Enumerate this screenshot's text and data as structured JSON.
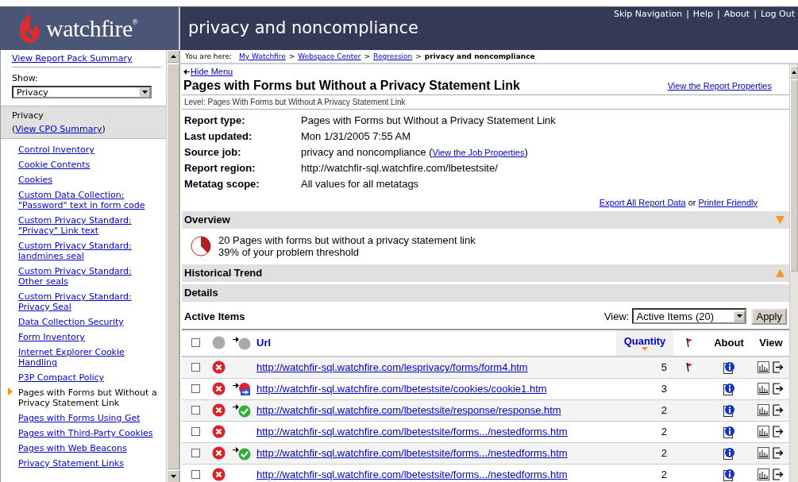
{
  "header": {
    "logo_text": "watchfire",
    "logo_mark": "®",
    "title": "privacy and noncompliance",
    "links": [
      "Skip Navigation",
      "Help",
      "About",
      "Log Out"
    ],
    "separator": "|"
  },
  "sidebar": {
    "summary_link": "View Report Pack Summary",
    "show_label": "Show:",
    "show_value": "Privacy",
    "group_title": "Privacy",
    "group_link_open": "(",
    "group_link": "View CPO Summary",
    "group_link_close": ")",
    "items": [
      {
        "label": "Control Inventory",
        "selected": false
      },
      {
        "label": "Cookie Contents",
        "selected": false
      },
      {
        "label": "Cookies",
        "selected": false
      },
      {
        "label": "Custom Data Collection: \"Password\" text in form code",
        "selected": false
      },
      {
        "label": "Custom Privacy Standard: \"Privacy\" Link text",
        "selected": false
      },
      {
        "label": "Custom Privacy Standard: landmines seal",
        "selected": false
      },
      {
        "label": "Custom Privacy Standard: Other seals",
        "selected": false
      },
      {
        "label": "Custom Privacy Standard: Privacy Seal",
        "selected": false
      },
      {
        "label": "Data Collection Security",
        "selected": false
      },
      {
        "label": "Form Inventory",
        "selected": false
      },
      {
        "label": "Internet Explorer Cookie Handling",
        "selected": false
      },
      {
        "label": "P3P Compact Policy",
        "selected": false
      },
      {
        "label": "Pages with Forms but Without a Privacy Statement Link",
        "selected": true
      },
      {
        "label": "Pages with Forms Using Get",
        "selected": false
      },
      {
        "label": "Pages with Third-Party Cookies",
        "selected": false
      },
      {
        "label": "Pages with Web Beacons",
        "selected": false
      },
      {
        "label": "Privacy Statement Links",
        "selected": false
      }
    ]
  },
  "breadcrumb": {
    "prefix": "You are here:",
    "links": [
      "My Watchfire",
      "Webspace Center",
      "Regression"
    ],
    "separator": ">",
    "current": "privacy and noncompliance"
  },
  "hide_menu": "Hide Menu",
  "report": {
    "title": "Pages with Forms but Without a Privacy Statement Link",
    "properties_link": "View the Report Properties",
    "level": "Level:  Pages With Forms but Without A Privacy Statement Link",
    "properties": [
      {
        "label": "Report type:",
        "value": "Pages with Forms but Without a Privacy Statement Link"
      },
      {
        "label": "Last updated:",
        "value": "Mon 1/31/2005 7:55 AM"
      },
      {
        "label": "Source job:",
        "value": "privacy and noncompliance",
        "link_open": "(",
        "link": "View the Job Properties",
        "link_close": ")"
      },
      {
        "label": "Report region:",
        "value": "http://watchfir-sql.watchfire.com/lbetestsite/"
      },
      {
        "label": "Metatag scope:",
        "value": "All values for all metatags"
      }
    ],
    "export_link": "Export All Report Data",
    "export_or": "or",
    "printer_link": "Printer Friendly"
  },
  "sections": [
    {
      "title": "Overview",
      "kind": "expanded"
    },
    {
      "title": "Historical Trend",
      "kind": "collapsed"
    },
    {
      "title": "Details",
      "kind": "plain"
    }
  ],
  "overview": {
    "lines": [
      "20 Pages with forms but without a privacy statement link",
      "39% of your problem threshold"
    ]
  },
  "active_items": {
    "title": "Active Items",
    "view_label": "View:",
    "view_value": "Active Items (20)",
    "apply": "Apply"
  },
  "table": {
    "all_checked": false,
    "columns": [
      {
        "label": "Url",
        "sorted": false
      },
      {
        "label": "Quantity",
        "sorted": true
      },
      {
        "label": "About",
        "sorted": false
      },
      {
        "label": "View",
        "sorted": false
      }
    ],
    "rows": [
      {
        "checked": false,
        "kind": "plain",
        "url": "http://watchfir-sql.watchfire.com/lesprivacy/forms/form4.htm",
        "quantity": "5",
        "flagged": true
      },
      {
        "checked": false,
        "kind": "new",
        "url": "http://watchfir-sql.watchfire.com/lbetestsite/cookies/cookie1.htm",
        "quantity": "3",
        "flagged": false
      },
      {
        "checked": false,
        "kind": "fixed",
        "url": "http://watchfir-sql.watchfire.com/lbetestsite/response/response.htm",
        "quantity": "2",
        "flagged": false
      },
      {
        "checked": false,
        "kind": "plain",
        "url": "http://watchfir-sql.watchfire.com/lbetestsite/forms.../nestedforms.htm",
        "quantity": "2",
        "flagged": false
      },
      {
        "checked": false,
        "kind": "fixed",
        "url": "http://watchfir-sql.watchfire.com/lbetestsite/forms.../nestedforms.htm",
        "quantity": "2",
        "flagged": false
      },
      {
        "checked": false,
        "kind": "plain",
        "url": "http://watchfir-sql.watchfire.com/lbetestsite/forms.../nestedforms.htm",
        "quantity": "2",
        "flagged": false
      }
    ]
  }
}
